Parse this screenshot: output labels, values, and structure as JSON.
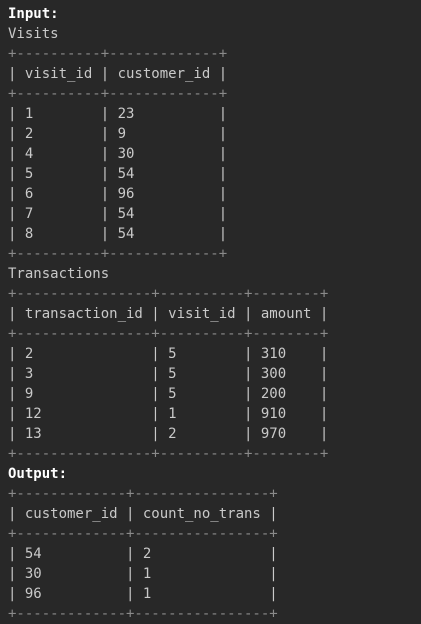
{
  "lines": [
    {
      "kind": "heading",
      "text": "Input:"
    },
    {
      "kind": "table-name",
      "text": "Visits"
    },
    {
      "kind": "border",
      "text": "+----------+-------------+"
    },
    {
      "kind": "header-row",
      "text": "| visit_id | customer_id |"
    },
    {
      "kind": "border",
      "text": "+----------+-------------+"
    },
    {
      "kind": "row",
      "text": "| 1        | 23          |"
    },
    {
      "kind": "row",
      "text": "| 2        | 9           |"
    },
    {
      "kind": "row",
      "text": "| 4        | 30          |"
    },
    {
      "kind": "row",
      "text": "| 5        | 54          |"
    },
    {
      "kind": "row",
      "text": "| 6        | 96          |"
    },
    {
      "kind": "row",
      "text": "| 7        | 54          |"
    },
    {
      "kind": "row",
      "text": "| 8        | 54          |"
    },
    {
      "kind": "border",
      "text": "+----------+-------------+"
    },
    {
      "kind": "table-name",
      "text": "Transactions"
    },
    {
      "kind": "border",
      "text": "+----------------+----------+--------+"
    },
    {
      "kind": "header-row",
      "text": "| transaction_id | visit_id | amount |"
    },
    {
      "kind": "border",
      "text": "+----------------+----------+--------+"
    },
    {
      "kind": "row",
      "text": "| 2              | 5        | 310    |"
    },
    {
      "kind": "row",
      "text": "| 3              | 5        | 300    |"
    },
    {
      "kind": "row",
      "text": "| 9              | 5        | 200    |"
    },
    {
      "kind": "row",
      "text": "| 12             | 1        | 910    |"
    },
    {
      "kind": "row",
      "text": "| 13             | 2        | 970    |"
    },
    {
      "kind": "border",
      "text": "+----------------+----------+--------+"
    },
    {
      "kind": "heading",
      "text": "Output:"
    },
    {
      "kind": "border",
      "text": "+-------------+----------------+"
    },
    {
      "kind": "header-row",
      "text": "| customer_id | count_no_trans |"
    },
    {
      "kind": "border",
      "text": "+-------------+----------------+"
    },
    {
      "kind": "row",
      "text": "| 54          | 2              |"
    },
    {
      "kind": "row",
      "text": "| 30          | 1              |"
    },
    {
      "kind": "row",
      "text": "| 96          | 1              |"
    },
    {
      "kind": "border",
      "text": "+-------------+----------------+"
    }
  ]
}
